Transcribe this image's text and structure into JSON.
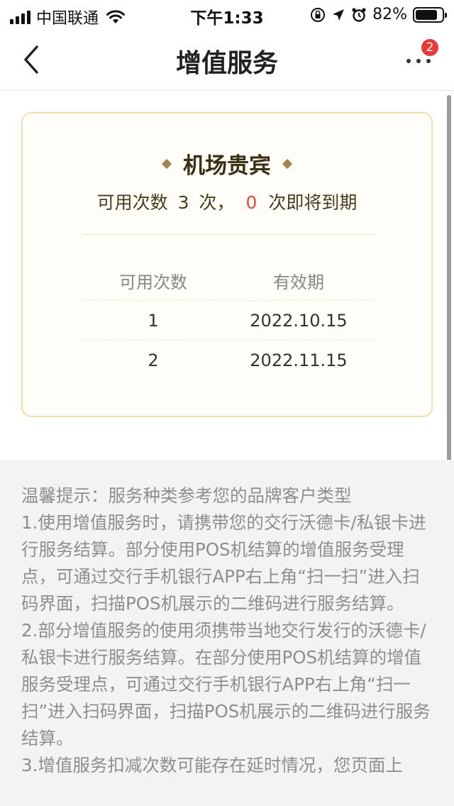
{
  "status_bar": {
    "carrier": "中国联通",
    "time": "下午1:33",
    "battery": "82%",
    "battery_level": 0.82
  },
  "nav": {
    "title": "增值服务",
    "badge": "2"
  },
  "card": {
    "title": "机场贵宾",
    "sub_prefix": "可用次数",
    "available_count": "3",
    "sub_mid": "次，",
    "expiring_count": "0",
    "sub_suffix": "次即将到期",
    "table": {
      "headers": [
        "可用次数",
        "有效期"
      ],
      "rows": [
        {
          "count": "1",
          "expiry": "2022.10.15"
        },
        {
          "count": "2",
          "expiry": "2022.11.15"
        }
      ]
    }
  },
  "tips": {
    "lines": [
      "温馨提示：服务种类参考您的品牌客户类型",
      "1.使用增值服务时，请携带您的交行沃德卡/私银卡进行服务结算。部分使用POS机结算的增值服务受理点，可通过交行手机银行APP右上角“扫一扫”进入扫码界面，扫描POS机展示的二维码进行服务结算。",
      "2.部分增值服务的使用须携带当地交行发行的沃德卡/私银卡进行服务结算。在部分使用POS机结算的增值服务受理点，可通过交行手机银行APP右上角“扫一扫”进入扫码界面，扫描POS机展示的二维码进行服务结算。",
      "3.增值服务扣减次数可能存在延时情况，您页面上"
    ]
  },
  "colors": {
    "accent_gold": "#a5834d",
    "card_border": "#f1dfae",
    "alert_red": "#e64a3b"
  }
}
